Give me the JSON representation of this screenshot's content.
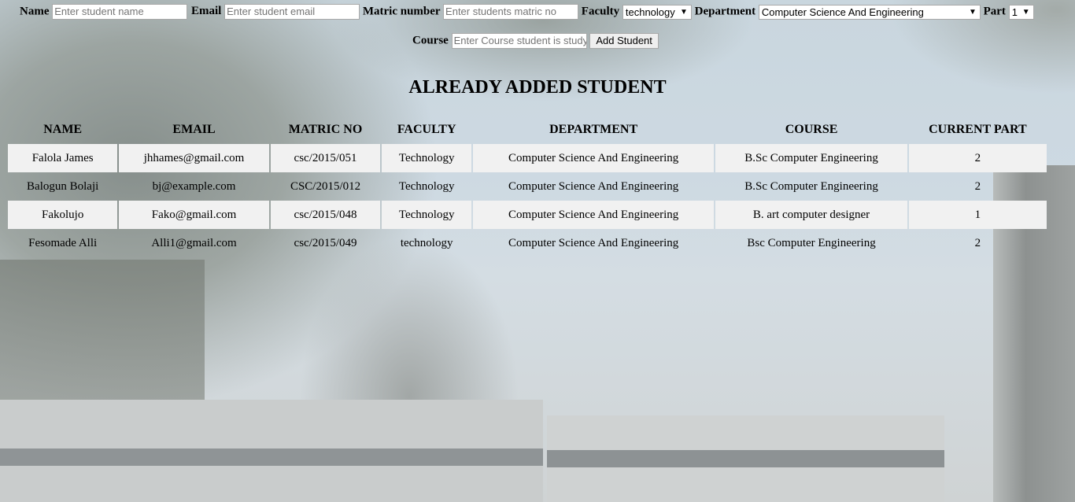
{
  "form": {
    "name_label": "Name",
    "name_placeholder": "Enter student name",
    "email_label": "Email",
    "email_placeholder": "Enter student email",
    "matric_label": "Matric number",
    "matric_placeholder": "Enter students matric no",
    "faculty_label": "Faculty",
    "faculty_value": "technology",
    "department_label": "Department",
    "department_value": "Computer Science And Engineering",
    "part_label": "Part",
    "part_value": "1",
    "course_label": "Course",
    "course_placeholder": "Enter Course student is studying",
    "add_button": "Add Student"
  },
  "title": "ALREADY ADDED STUDENT",
  "table": {
    "headers": [
      "NAME",
      "EMAIL",
      "MATRIC NO",
      "FACULTY",
      "DEPARTMENT",
      "COURSE",
      "CURRENT PART"
    ],
    "rows": [
      [
        "Falola James",
        "jhhames@gmail.com",
        "csc/2015/051",
        "Technology",
        "Computer Science And Engineering",
        "B.Sc Computer Engineering",
        "2"
      ],
      [
        "Balogun Bolaji",
        "bj@example.com",
        "CSC/2015/012",
        "Technology",
        "Computer Science And Engineering",
        "B.Sc Computer Engineering",
        "2"
      ],
      [
        "Fakolujo",
        "Fako@gmail.com",
        "csc/2015/048",
        "Technology",
        "Computer Science And Engineering",
        "B. art computer designer",
        "1"
      ],
      [
        "Fesomade Alli",
        "Alli1@gmail.com",
        "csc/2015/049",
        "technology",
        "Computer Science And Engineering",
        "Bsc Computer Engineering",
        "2"
      ]
    ]
  },
  "icons": {
    "dropdown_arrow": "chevron-down-icon"
  }
}
